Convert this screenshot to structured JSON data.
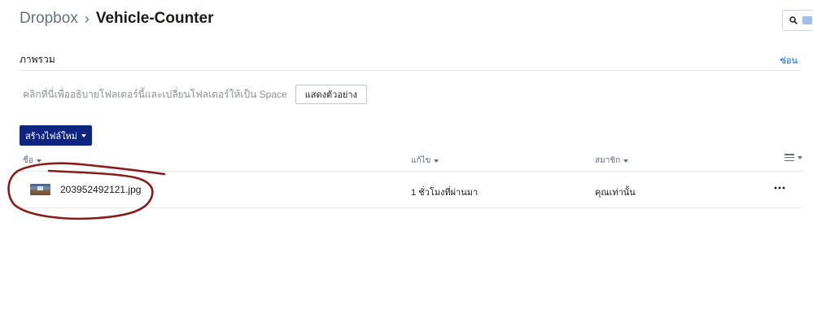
{
  "breadcrumb": {
    "root": "Dropbox",
    "separator": "›",
    "current": "Vehicle-Counter"
  },
  "overview": {
    "title": "ภาพรวม",
    "hide_label": "ซ่อน"
  },
  "description": {
    "text": "คลิกที่นี่เพื่ออธิบายโฟลเดอร์นี้และเปลี่ยนโฟลเดอร์ให้เป็น Space",
    "example_button": "แสดงตัวอย่าง"
  },
  "new_file_button": "สร้างไฟล์ใหม่",
  "table": {
    "columns": {
      "name": "ชื่อ",
      "modified": "แก้ไข",
      "members": "สมาชิก"
    },
    "rows": [
      {
        "name": "203952492121.jpg",
        "modified": "1 ชั่วโมงที่ผ่านมา",
        "members": "คุณเท่านั้น"
      }
    ]
  },
  "icons": {
    "search": "search-icon",
    "view": "list-view-icon",
    "more": "more-icon",
    "caret": "caret-down-icon"
  },
  "colors": {
    "primary_button": "#0d2481",
    "link": "#0061fe",
    "annotation": "#8b1a1a",
    "muted_text": "#637282"
  }
}
